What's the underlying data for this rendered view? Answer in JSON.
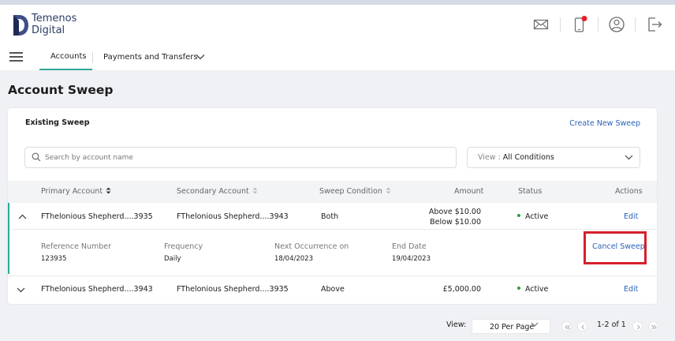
{
  "app": {
    "logo_line1": "Temenos",
    "logo_line2": "Digital"
  },
  "header": {
    "icons": [
      "mail-icon",
      "mobile-notification-icon",
      "user-profile-icon",
      "logout-icon"
    ],
    "notification_color": "#e8202a"
  },
  "nav": {
    "tabs": [
      {
        "label": "Accounts",
        "active": true
      },
      {
        "label": "Payments and Transfers",
        "active": false
      }
    ]
  },
  "page": {
    "title": "Account Sweep"
  },
  "card": {
    "title": "Existing Sweep",
    "create_link": "Create New Sweep"
  },
  "search": {
    "placeholder": "Search by account name",
    "value": ""
  },
  "view_filter": {
    "label": "View : ",
    "value": "All Conditions"
  },
  "table": {
    "columns": [
      "Primary Account",
      "Secondary Account",
      "Sweep Condition",
      "Amount",
      "Status",
      "Actions"
    ],
    "rows": [
      {
        "primary": "FThelonious Shepherd....3935",
        "secondary": "FThelonious Shepherd....3943",
        "condition": "Both",
        "amount_line1": "Above $10.00",
        "amount_line2": "Below $10.00",
        "status": "Active",
        "action": "Edit",
        "expanded": true,
        "details": {
          "labels": [
            "Reference Number",
            "Frequency",
            "Next Occurrence on",
            "End Date"
          ],
          "values": [
            "123935",
            "Daily",
            "18/04/2023",
            "19/04/2023"
          ],
          "cancel_label": "Cancel Sweep"
        }
      },
      {
        "primary": "FThelonious Shepherd....3943",
        "secondary": "FThelonious Shepherd....3935",
        "condition": "Above",
        "amount_line1": "£5,000.00",
        "status": "Active",
        "action": "Edit",
        "expanded": false
      }
    ]
  },
  "pagination": {
    "view_label": "View:",
    "per_page": "20 Per Page",
    "range": "1-2",
    "of_label": "of 1"
  },
  "colors": {
    "accent": "#2fa89a",
    "link": "#2a62b8",
    "status_active": "#2e9e44",
    "highlight_border": "#d6202c"
  }
}
